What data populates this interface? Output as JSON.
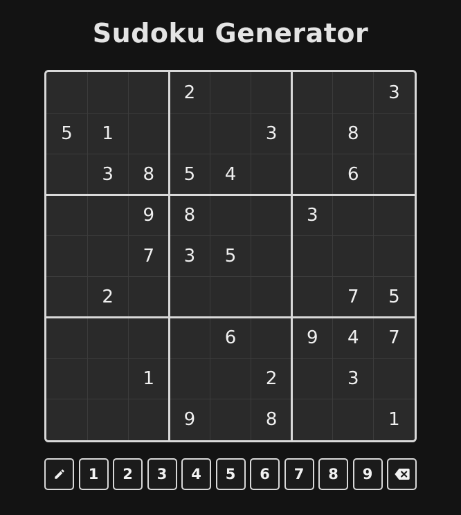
{
  "title": "Sudoku Generator",
  "board": {
    "cells": [
      [
        "",
        "",
        "",
        "2",
        "",
        "",
        "",
        "",
        "3"
      ],
      [
        "5",
        "1",
        "",
        "",
        "",
        "3",
        "",
        "8",
        ""
      ],
      [
        "",
        "3",
        "8",
        "5",
        "4",
        "",
        "",
        "6",
        ""
      ],
      [
        "",
        "",
        "9",
        "8",
        "",
        "",
        "3",
        "",
        ""
      ],
      [
        "",
        "",
        "7",
        "3",
        "5",
        "",
        "",
        "",
        ""
      ],
      [
        "",
        "2",
        "",
        "",
        "",
        "",
        "",
        "7",
        "5"
      ],
      [
        "",
        "",
        "",
        "",
        "6",
        "",
        "9",
        "4",
        "7"
      ],
      [
        "",
        "",
        "1",
        "",
        "",
        "2",
        "",
        "3",
        ""
      ],
      [
        "",
        "",
        "",
        "9",
        "",
        "8",
        "",
        "",
        "1"
      ]
    ]
  },
  "keypad": {
    "pencil_icon": "pencil-icon",
    "digits": [
      "1",
      "2",
      "3",
      "4",
      "5",
      "6",
      "7",
      "8",
      "9"
    ],
    "erase_icon": "backspace-icon"
  },
  "colors": {
    "background": "#131313",
    "cell": "#2a2a2a",
    "text": "#f0f0f0",
    "border": "#d9d9d9"
  }
}
